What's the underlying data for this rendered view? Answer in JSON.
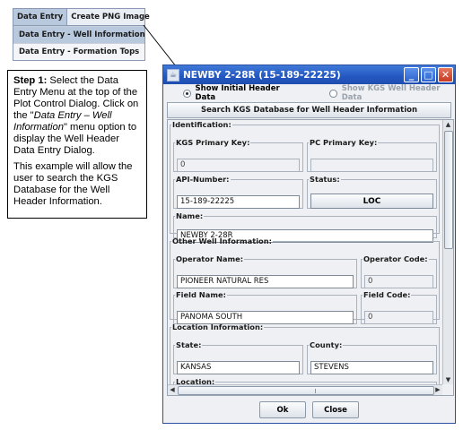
{
  "menu": {
    "bar": [
      "Data Entry",
      "Create PNG Image"
    ],
    "items": [
      "Data Entry - Well Information",
      "Data Entry - Formation Tops"
    ]
  },
  "callout": {
    "step_label": "Step 1:",
    "step_text_1": " Select the Data Entry Menu at the top of the Plot Control Dialog. Click on the \"",
    "step_italic": "Data Entry – Well Information",
    "step_text_2": "\" menu option to display the Well Header Data Entry Dialog.",
    "para2": "This example will allow the user to search the KGS Database for the Well Header Information."
  },
  "dialog": {
    "title": "NEWBY 2-28R (15-189-22225)",
    "icons": {
      "app": "java-cup-icon",
      "minimize": "minimize-icon",
      "maximize": "maximize-icon",
      "close": "close-icon"
    },
    "radio_initial": "Show Initial Header Data",
    "radio_kgs": "Show KGS Well Header Data",
    "search_button": "Search KGS Database for Well Header Information",
    "identification": {
      "legend": "Identification:",
      "kgs_key_label": "KGS Primary Key:",
      "kgs_key_value": "0",
      "pc_key_label": "PC Primary Key:",
      "pc_key_value": "",
      "api_label": "API-Number:",
      "api_value": "15-189-22225",
      "status_label": "Status:",
      "status_value": "LOC",
      "name_label": "Name:",
      "name_value": "NEWBY 2-28R"
    },
    "other": {
      "legend": "Other Well Information:",
      "operator_label": "Operator Name:",
      "operator_value": "PIONEER NATURAL RES",
      "operator_code_label": "Operator Code:",
      "operator_code_value": "0",
      "field_label": "Field Name:",
      "field_value": "PANOMA SOUTH",
      "field_code_label": "Field Code:",
      "field_code_value": "0"
    },
    "location": {
      "legend": "Location Information:",
      "state_label": "State:",
      "state_value": "KANSAS",
      "county_label": "County:",
      "county_value": "STEVENS",
      "location_label": "Location:"
    },
    "ok_button": "Ok",
    "close_button": "Close"
  },
  "colors": {
    "title_bar": "#2457c1",
    "menu_highlight": "#b9c9dd",
    "dialog_bg": "#eef0f3"
  }
}
